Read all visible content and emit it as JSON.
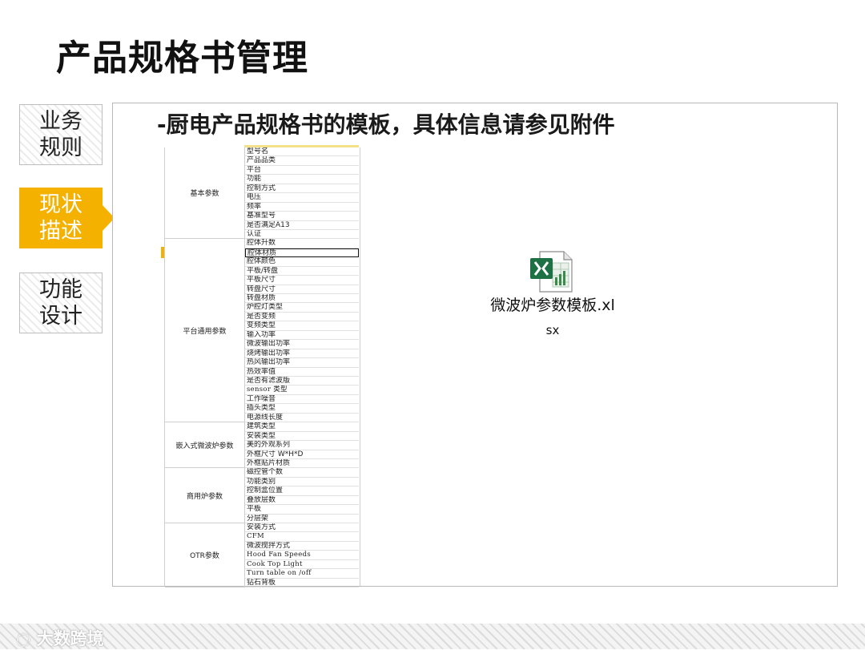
{
  "title": "产品规格书管理",
  "nav": {
    "items": [
      {
        "label_line1": "业务",
        "label_line2": "规则"
      },
      {
        "label_line1": "现状",
        "label_line2": "描述"
      },
      {
        "label_line1": "功能",
        "label_line2": "设计"
      }
    ]
  },
  "main": {
    "heading": "-厨电产品规格书的模板，具体信息请参见附件",
    "attachment": {
      "name_line1": "微波炉参数模板.xl",
      "name_line2": "sx",
      "icon": "excel-file-icon"
    }
  },
  "spreadsheet": {
    "categories": [
      {
        "name": "基本参数",
        "rows": [
          "型号名",
          "产品品类",
          "平台",
          "功能",
          "控制方式",
          "电压",
          "频率",
          "基准型号",
          "是否满足A13",
          "认证"
        ]
      },
      {
        "name": "平台通用参数",
        "rows": [
          "腔体升数",
          "腔体材质",
          "腔体颜色",
          "平板/转盘",
          "平板尺寸",
          "转盘尺寸",
          "转盘材质",
          "炉腔灯类型",
          "是否变频",
          "变频类型",
          "输入功率",
          "微波输出功率",
          "烧烤输出功率",
          "热风输出功率",
          "热效率值",
          "是否有滤波版",
          "sensor 类型",
          "工作噪音",
          "插头类型",
          "电源线长度"
        ]
      },
      {
        "name": "嵌入式微波炉参数",
        "rows": [
          "建筑类型",
          "安装类型",
          "美的外观系列",
          "外框尺寸 W*H*D",
          "外框贴片材质"
        ]
      },
      {
        "name": "商用炉参数",
        "rows": [
          "磁控管个数",
          "功能类别",
          "控制盒位置",
          "叠放层数",
          "平板",
          "分层架"
        ]
      },
      {
        "name": "OTR参数",
        "rows": [
          "安装方式",
          "CFM",
          "微波搅拌方式",
          "Hood Fan Speeds",
          "Cook Top Light",
          "Turn table on /off",
          "钻石背板"
        ]
      }
    ],
    "selected_row": "腔体材质"
  },
  "footer": {
    "watermark": "大数跨境"
  },
  "colors": {
    "accent": "#f5b100",
    "excel_green": "#1e7145"
  }
}
